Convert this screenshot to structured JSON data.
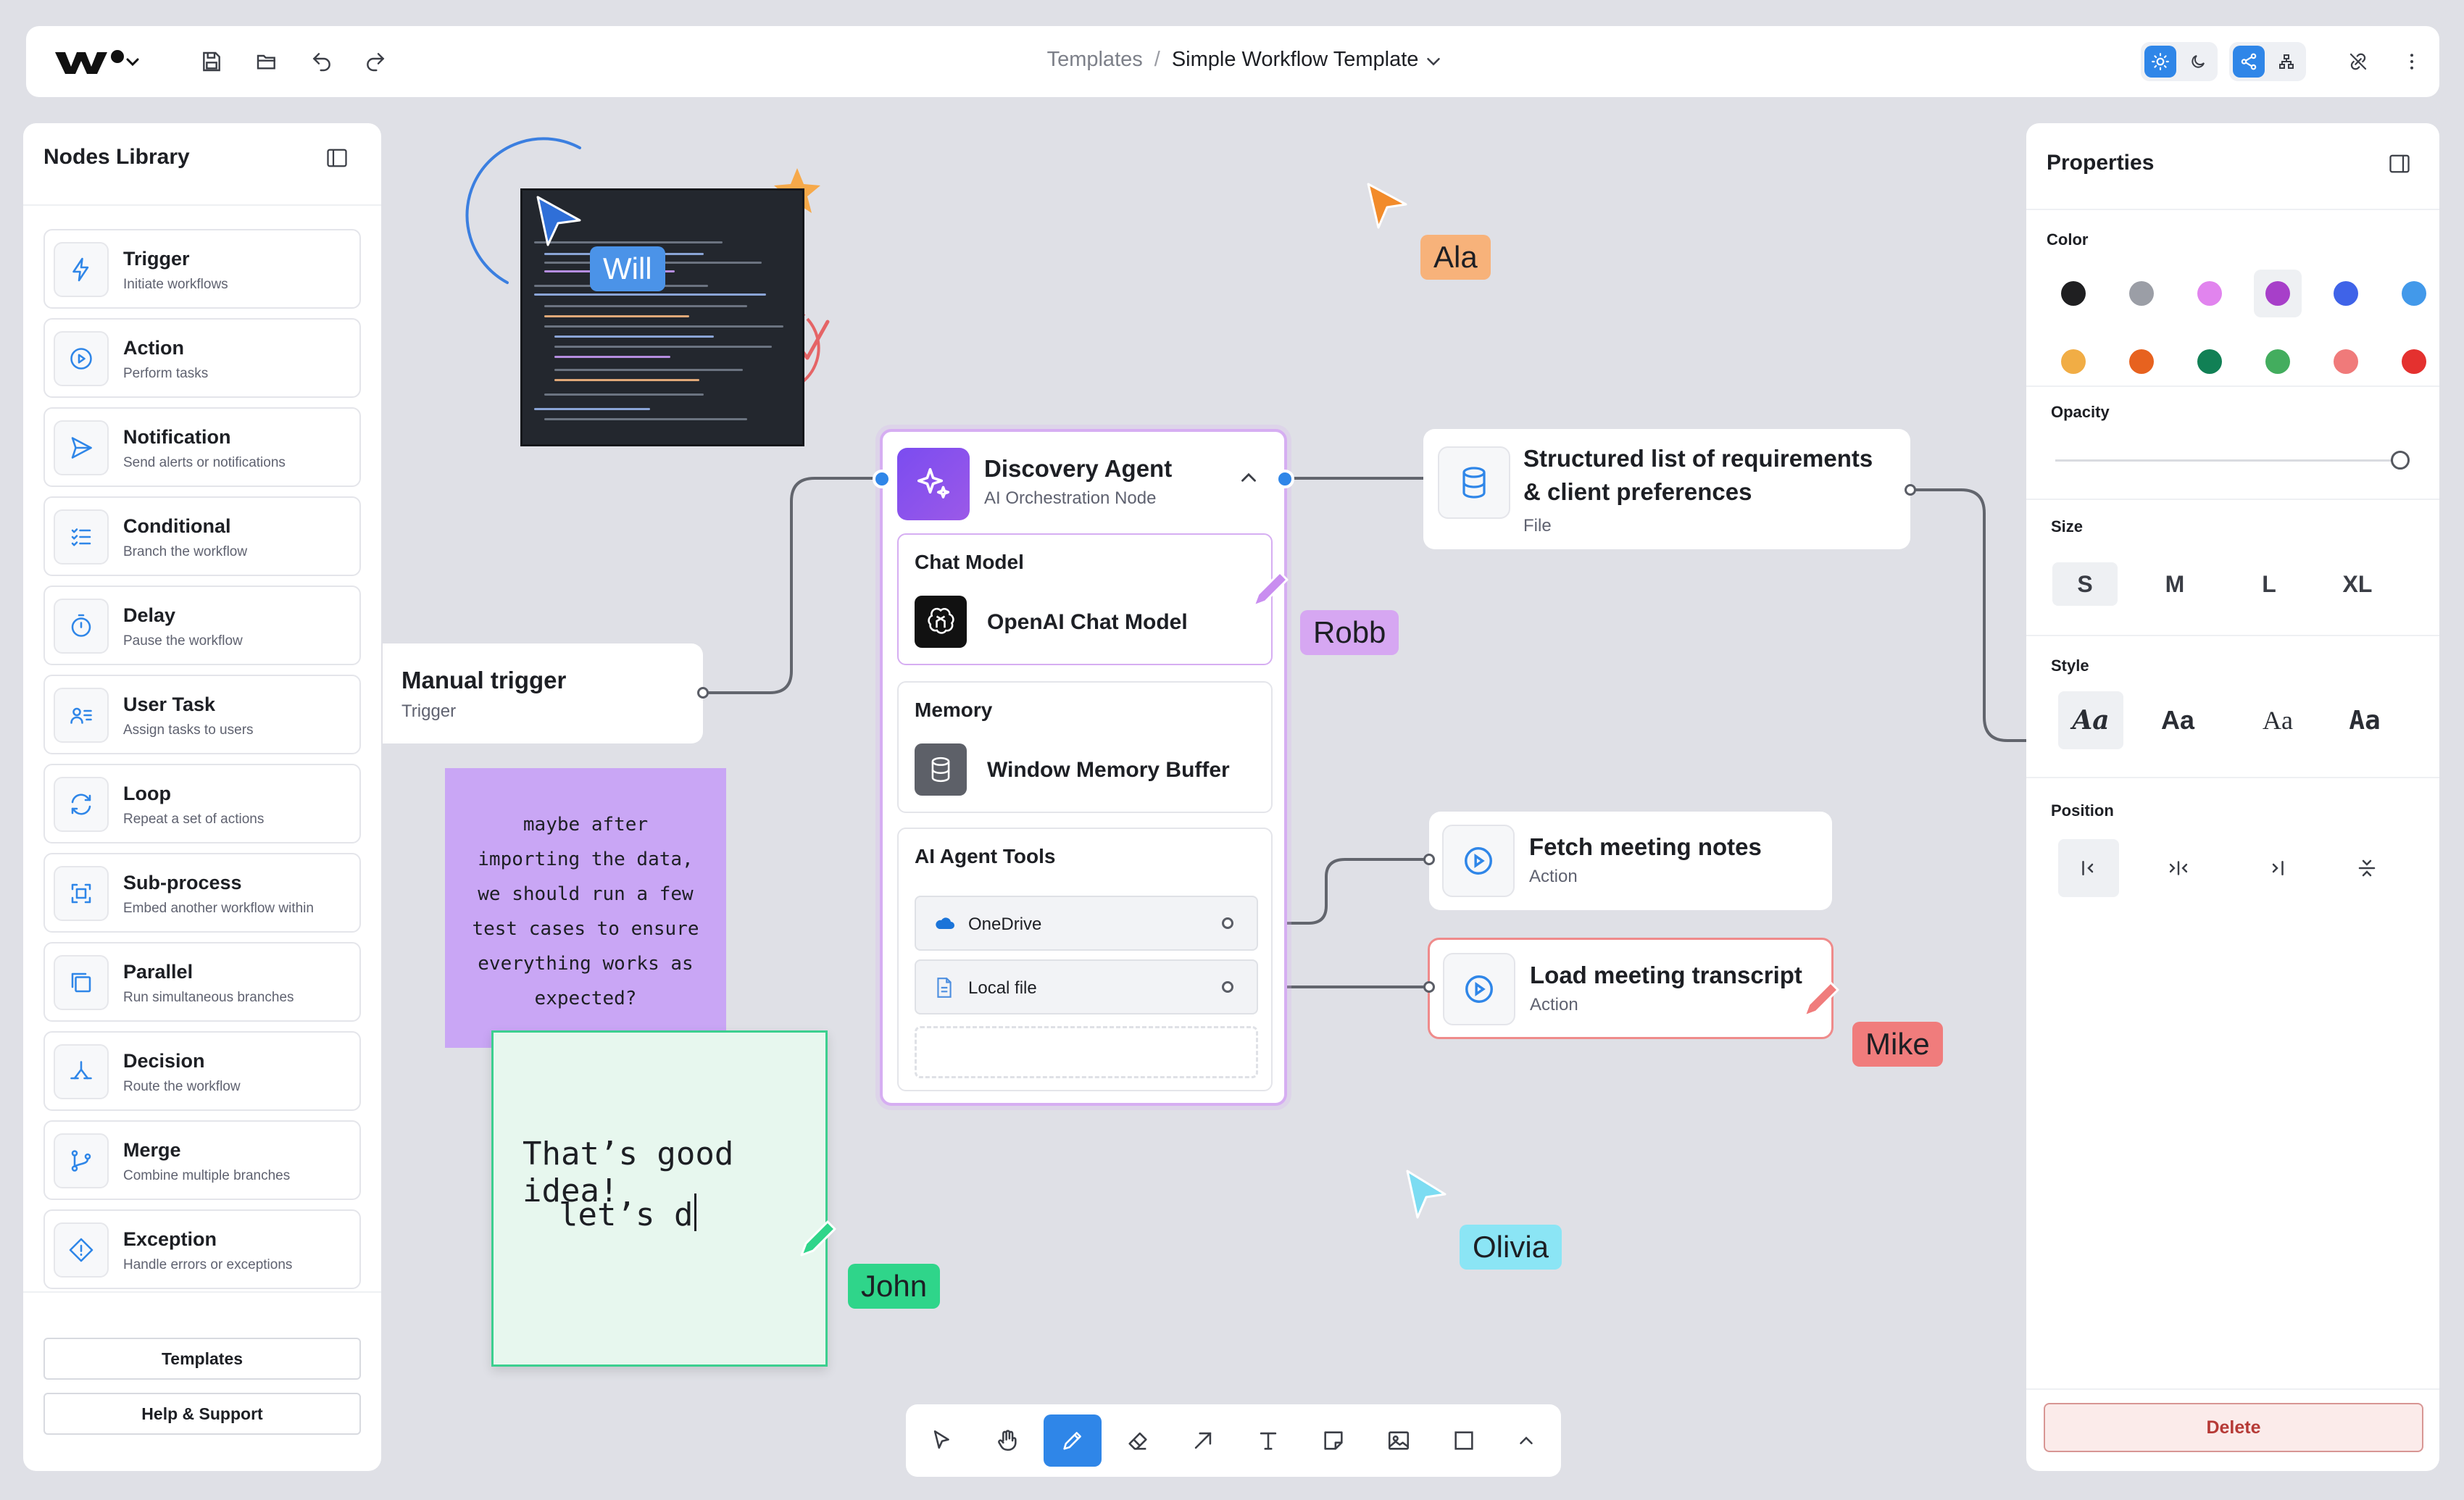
{
  "topbar": {
    "breadcrumb_parent": "Templates",
    "breadcrumb_separator": "/",
    "breadcrumb_current": "Simple Workflow Template"
  },
  "library": {
    "title": "Nodes Library",
    "items": [
      {
        "name": "Trigger",
        "desc": "Initiate workflows",
        "icon": "bolt-icon"
      },
      {
        "name": "Action",
        "desc": "Perform tasks",
        "icon": "play-icon"
      },
      {
        "name": "Notification",
        "desc": "Send alerts or notifications",
        "icon": "send-icon"
      },
      {
        "name": "Conditional",
        "desc": "Branch the workflow",
        "icon": "checklist-icon"
      },
      {
        "name": "Delay",
        "desc": "Pause the workflow",
        "icon": "timer-icon"
      },
      {
        "name": "User Task",
        "desc": "Assign tasks to users",
        "icon": "user-list-icon"
      },
      {
        "name": "Loop",
        "desc": "Repeat a set of actions",
        "icon": "loop-icon"
      },
      {
        "name": "Sub-process",
        "desc": "Embed another workflow within",
        "icon": "frame-icon"
      },
      {
        "name": "Parallel",
        "desc": "Run simultaneous branches",
        "icon": "copy-icon"
      },
      {
        "name": "Decision",
        "desc": "Route the workflow",
        "icon": "split-icon"
      },
      {
        "name": "Merge",
        "desc": "Combine multiple branches",
        "icon": "merge-icon"
      },
      {
        "name": "Exception",
        "desc": "Handle errors or exceptions",
        "icon": "warning-diamond-icon"
      }
    ],
    "templates_button": "Templates",
    "help_button": "Help & Support"
  },
  "properties": {
    "title": "Properties",
    "color_label": "Color",
    "colors": [
      "#1f1f21",
      "#9b9ea6",
      "#e184ee",
      "#a73fc9",
      "#3f63e8",
      "#4299ea",
      "#f1ad45",
      "#e7621f",
      "#118055",
      "#43ad5e",
      "#f07a7a",
      "#e4312f"
    ],
    "selected_color": "#a73fc9",
    "opacity_label": "Opacity",
    "opacity_value": 1.0,
    "size_label": "Size",
    "sizes": [
      "S",
      "M",
      "L",
      "XL"
    ],
    "selected_size": "S",
    "style_label": "Style",
    "styles": [
      "Aa",
      "Aa",
      "Aa",
      "Aa"
    ],
    "position_label": "Position",
    "delete_button": "Delete"
  },
  "canvas": {
    "manual_trigger": {
      "title": "Manual trigger",
      "subtitle": "Trigger"
    },
    "agent": {
      "title": "Discovery Agent",
      "subtitle": "AI Orchestration Node",
      "chat_model_label": "Chat Model",
      "chat_model_value": "OpenAI Chat Model",
      "memory_label": "Memory",
      "memory_value": "Window Memory Buffer",
      "tools_label": "AI Agent Tools",
      "tools": [
        "OneDrive",
        "Local file"
      ]
    },
    "requirements": {
      "title_line1": "Structured list of requirements",
      "title_line2": "& client preferences",
      "subtitle": "File"
    },
    "fetch": {
      "title": "Fetch meeting notes",
      "subtitle": "Action"
    },
    "load": {
      "title": "Load meeting transcript",
      "subtitle": "Action"
    },
    "sticky_purple": [
      "maybe after",
      "importing the data,",
      "we should run a few",
      "test cases to ensure",
      "everything works as",
      "expected?"
    ],
    "sticky_green": [
      "That’s good idea!",
      "let’s d"
    ],
    "cursors": [
      {
        "name": "Will",
        "color": "#4b93e8"
      },
      {
        "name": "Ala",
        "color": "#f7b27a"
      },
      {
        "name": "Robb",
        "color": "#d6a7f2"
      },
      {
        "name": "Mike",
        "color": "#f07c7c"
      },
      {
        "name": "Olivia",
        "color": "#8be5f5"
      },
      {
        "name": "John",
        "color": "#2fd58a"
      }
    ]
  },
  "toolbar": {
    "tools": [
      "select-tool",
      "hand-tool",
      "pen-tool",
      "eraser-tool",
      "arrow-tool",
      "text-tool",
      "sticky-note-tool",
      "image-tool",
      "rectangle-tool",
      "expand-chevron"
    ],
    "active_tool": "pen-tool"
  }
}
